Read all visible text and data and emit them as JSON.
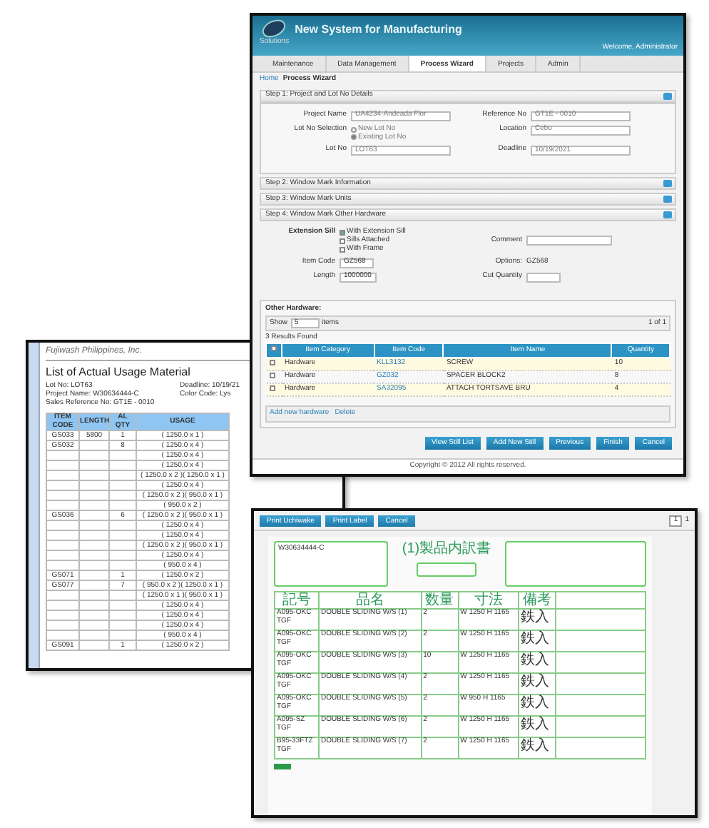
{
  "report": {
    "company": "Fujiwash Philippines, Inc.",
    "title": "List of Actual Usage Material",
    "meta_left": [
      "Lot No: LOT63",
      "Project Name: W30634444-C",
      "Sales Reference No: GT1E - 0010"
    ],
    "meta_right": [
      "Deadline: 10/19/21",
      "Color Code: Lys"
    ],
    "columns": [
      "ITEM CODE",
      "LENGTH",
      "AL QTY",
      "USAGE"
    ],
    "rows": [
      {
        "item_code": "GS033",
        "length": "5800",
        "al_qty": "1",
        "usage": "( 1250.0 x 1 )"
      },
      {
        "item_code": "GS032",
        "al_qty": "8",
        "usage": "( 1250.0 x 4 )"
      },
      {
        "usage": "( 1250.0 x 4 )"
      },
      {
        "usage": "( 1250.0 x 4 )"
      },
      {
        "usage": "( 1250.0 x 2 )( 1250.0 x 1 )"
      },
      {
        "usage": "( 1250.0 x 4 )"
      },
      {
        "usage": "( 1250.0 x 2 )( 950.0 x 1 )"
      },
      {
        "usage": "( 950.0 x 2 )"
      },
      {
        "item_code": "GS036",
        "al_qty": "6",
        "usage": "( 1250.0 x 2 )( 950.0 x 1 )"
      },
      {
        "usage": "( 1250.0 x 4 )"
      },
      {
        "usage": "( 1250.0 x 4 )"
      },
      {
        "usage": "( 1250.0 x 2 )( 950.0 x 1 )"
      },
      {
        "usage": "( 1250.0 x 4 )"
      },
      {
        "usage": "( 950.0 x 4 )"
      },
      {
        "item_code": "GS071",
        "al_qty": "1",
        "usage": "( 1250.0 x 2 )"
      },
      {
        "item_code": "GS077",
        "al_qty": "7",
        "usage": "( 950.0 x 2 )( 1250.0 x 1 )"
      },
      {
        "usage": "( 1250.0 x 1 )( 950.0 x 1 )"
      },
      {
        "usage": "( 1250.0 x 4 )"
      },
      {
        "usage": "( 1250.0 x 4 )"
      },
      {
        "usage": "( 1250.0 x 4 )"
      },
      {
        "usage": "( 950.0 x 4 )"
      },
      {
        "item_code": "GS091",
        "al_qty": "1",
        "usage": "( 1250.0 x 2 )"
      }
    ]
  },
  "app": {
    "title": "New System for Manufacturing",
    "logo_caption": "Solutions",
    "user": "Welcome, Administrator",
    "nav": [
      {
        "label": "Maintenance",
        "selected": false
      },
      {
        "label": "Data Management",
        "selected": false
      },
      {
        "label": "Process Wizard",
        "selected": true
      },
      {
        "label": "Projects",
        "selected": false
      },
      {
        "label": "Admin",
        "selected": false
      }
    ],
    "breadcrumb": {
      "home": "Home",
      "current": "Process Wizard"
    },
    "step1": {
      "title": "Step 1: Project and Lot No Details",
      "project_label": "Project Name",
      "project_value": "UA4234-Andeada Flor",
      "reference_label": "Reference No",
      "reference_value": "GT1E - 0010",
      "lot_selection_label": "Lot No Selection",
      "lot_options": [
        {
          "label": "New Lot No",
          "selected": false
        },
        {
          "label": "Existing Lot No",
          "selected": true
        }
      ],
      "location_label": "Location",
      "location_value": "Cebu",
      "lot_label": "Lot No",
      "lot_value": "LOT63",
      "deadline_label": "Deadline",
      "deadline_value": "10/19/2021"
    },
    "steps": [
      "Step 2: Window Mark Information",
      "Step 3: Window Mark Units",
      "Step 4: Window Mark Other Hardware"
    ],
    "step4": {
      "extension_label": "Extension Sill",
      "checks": [
        {
          "label": "With Extension Sill",
          "checked": true
        },
        {
          "label": "Sills Attached",
          "checked": false
        },
        {
          "label": "With Frame",
          "checked": false
        }
      ],
      "comment_label": "Comment",
      "item_code_label": "Item Code",
      "item_code_value": "GZ568",
      "options_label": "Options:",
      "options_value": "GZ568",
      "length_label": "Length",
      "length_value": "1000000",
      "cut_label": "Cut Quantity"
    },
    "hardware": {
      "title": "Other Hardware:",
      "show_label": "Show",
      "show_value": "5",
      "items_label": "items",
      "pager": "1 of 1",
      "results": "3 Results Found",
      "all_checked": false,
      "columns": [
        "Item Category",
        "Item Code",
        "Item Name",
        "Quantity"
      ],
      "rows": [
        {
          "category": "Hardware",
          "code": "KLL3132",
          "name": "SCREW",
          "quantity": "10",
          "checked": false
        },
        {
          "category": "Hardware",
          "code": "GZ032",
          "name": "SPACER BLOCK2",
          "quantity": "8",
          "checked": false
        },
        {
          "category": "Hardware",
          "code": "SA32095",
          "name": "ATTACH TORTSAVE BRU",
          "quantity": "4",
          "checked": false
        }
      ],
      "links": [
        "Add new hardware",
        "Delete"
      ]
    },
    "buttons": [
      "View Still List",
      "Add New Still",
      "Previous",
      "Finish",
      "Cancel"
    ],
    "footer": "Copyright © 2012 All rights reserved."
  },
  "print": {
    "buttons": [
      "Print Uchiwake",
      "Print Label",
      "Cancel"
    ],
    "page": "1",
    "page_total": "1",
    "form_title": "(1)製品内訳書",
    "project": "W30634444-C",
    "columns": [
      "記号",
      "品名",
      "数量",
      "寸法",
      "備考"
    ],
    "rows": [
      {
        "code": "A095-OKC TGF",
        "name": "DOUBLE SLIDING W/S (1)",
        "qty": "2",
        "size": "W 1250 H 1165",
        "note": "鉄入"
      },
      {
        "code": "A095-OKC TGF",
        "name": "DOUBLE SLIDING W/S (2)",
        "qty": "2",
        "size": "W 1250 H 1165",
        "note": "鉄入"
      },
      {
        "code": "A095-OKC TGF",
        "name": "DOUBLE SLIDING W/S (3)",
        "qty": "10",
        "size": "W 1250 H 1165",
        "note": "鉄入"
      },
      {
        "code": "A095-OKC TGF",
        "name": "DOUBLE SLIDING W/S (4)",
        "qty": "2",
        "size": "W 1250 H 1165",
        "note": "鉄入"
      },
      {
        "code": "A095-OKC TGF",
        "name": "DOUBLE SLIDING W/S (5)",
        "qty": "2",
        "size": "W 950 H 1165",
        "note": "鉄入"
      },
      {
        "code": "A095-SZ TGF",
        "name": "DOUBLE SLIDING W/S (6)",
        "qty": "2",
        "size": "W 1250 H 1165",
        "note": "鉄入"
      },
      {
        "code": "B95-33FTZ TGF",
        "name": "DOUBLE SLIDING W/S (7)",
        "qty": "2",
        "size": "W 1250 H 1165",
        "note": "鉄入"
      }
    ]
  }
}
